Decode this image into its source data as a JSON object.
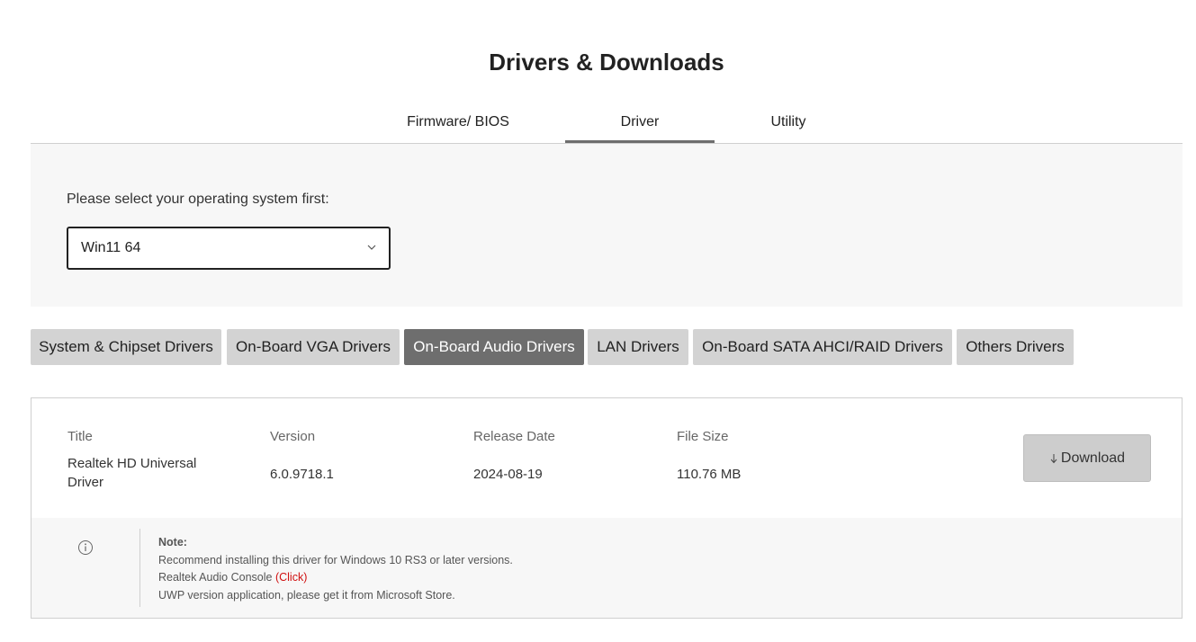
{
  "page": {
    "title": "Drivers & Downloads"
  },
  "tabs": [
    {
      "label": "Firmware/ BIOS",
      "active": false
    },
    {
      "label": "Driver",
      "active": true
    },
    {
      "label": "Utility",
      "active": false
    }
  ],
  "os_selector": {
    "label": "Please select your operating system first:",
    "selected": "Win11 64"
  },
  "categories": [
    {
      "label": "System & Chipset Drivers",
      "active": false
    },
    {
      "label": "On-Board VGA Drivers",
      "active": false
    },
    {
      "label": "On-Board Audio Drivers",
      "active": true
    },
    {
      "label": "LAN Drivers",
      "active": false
    },
    {
      "label": "On-Board SATA AHCI/RAID Drivers",
      "active": false
    },
    {
      "label": "Others Drivers",
      "active": false
    }
  ],
  "driver": {
    "headers": {
      "title": "Title",
      "version": "Version",
      "release_date": "Release Date",
      "file_size": "File Size"
    },
    "title_line1": "Realtek HD Universal",
    "title_line2": "Driver",
    "version": "6.0.9718.1",
    "release_date": "2024-08-19",
    "file_size": "110.76 MB",
    "download_label": "Download",
    "note": {
      "title": "Note:",
      "line1": "Recommend installing this driver for Windows 10 RS3 or later versions.",
      "line2_text": "Realtek Audio Console ",
      "line2_link": "(Click)",
      "line3": "UWP version application, please get it from Microsoft Store."
    }
  },
  "colors": {
    "active_tab_border": "#6e6e6e",
    "active_category_bg": "#6e6e6e",
    "category_bg": "#d3d3d3",
    "panel_bg": "#f7f7f7",
    "link": "#d01010"
  },
  "icons": {
    "select_chevron": "chevron-down-icon",
    "download": "download-arrow-icon",
    "note": "info-icon"
  }
}
